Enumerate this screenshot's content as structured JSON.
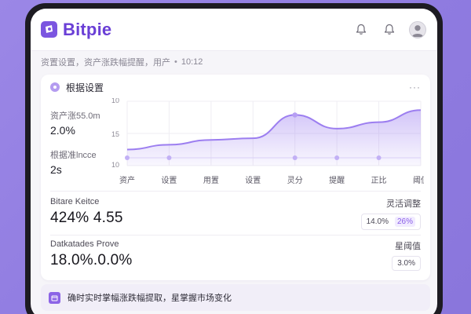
{
  "app": {
    "brand": "Bitpie",
    "brand_color": "#6a3fd6",
    "accent_color": "#8a5ee8",
    "icons": [
      "bell-icon",
      "bell-icon",
      "user-avatar-icon"
    ]
  },
  "breadcrumb": {
    "path": "资置设置，资产涨跌幅提醒，用产",
    "time": "10:12"
  },
  "card": {
    "title": "根据设置",
    "more": "···",
    "stat1": {
      "label": "资产涨55.0m",
      "value": "2.0%"
    },
    "stat2": {
      "label": "根据准lncce",
      "value": "2s"
    }
  },
  "chart_data": {
    "type": "area",
    "categories": [
      "资产",
      "设置",
      "用置",
      "设置",
      "灵分",
      "提醒",
      "正比",
      "阈值"
    ],
    "y_ticks": [
      "10",
      "15",
      "10"
    ],
    "series": [
      {
        "values": [
          12.0,
          12.6,
          13.2,
          13.4,
          16.3,
          14.6,
          15.4,
          16.9
        ]
      }
    ],
    "grid": true,
    "color": "#9c7ef0"
  },
  "metrics": {
    "row1": {
      "label": "Bitare Keitce",
      "value": "424%  4.55",
      "right_label": "灵活调整",
      "pill_a": "14.0%",
      "pill_b": "26%"
    },
    "row2": {
      "label": "Datkatades Prove",
      "value": "18.0%.0.0%",
      "right_label": "星阈值",
      "pill": "3.0%"
    }
  },
  "banner": {
    "text": "确时实时掌幅涨跌幅提取，星掌握市场变化"
  }
}
